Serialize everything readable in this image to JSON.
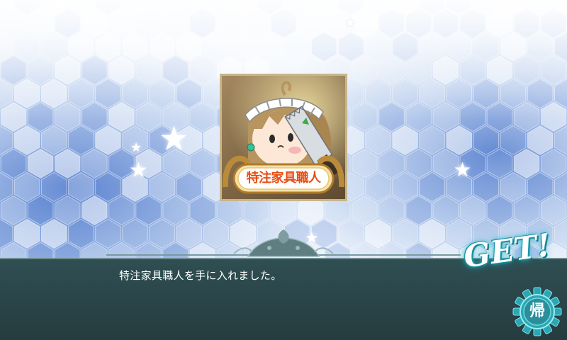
{
  "screen": "item-acquired",
  "item": {
    "name_label": "特注家具職人",
    "icon": "carpenter-girl-with-saw-portrait"
  },
  "message": "特注家具職人を手に入れました。",
  "get_banner": "GET!",
  "return_button": {
    "label": "帰",
    "icon": "gear-icon"
  },
  "colors": {
    "hex_light": "#e9f1fb",
    "hex_blue": "#3d6cc6",
    "message_bar": "#2c474b",
    "label_text": "#e84d12",
    "get_glow": "#1fb7c8",
    "gear_teal": "#2aa7b3"
  }
}
